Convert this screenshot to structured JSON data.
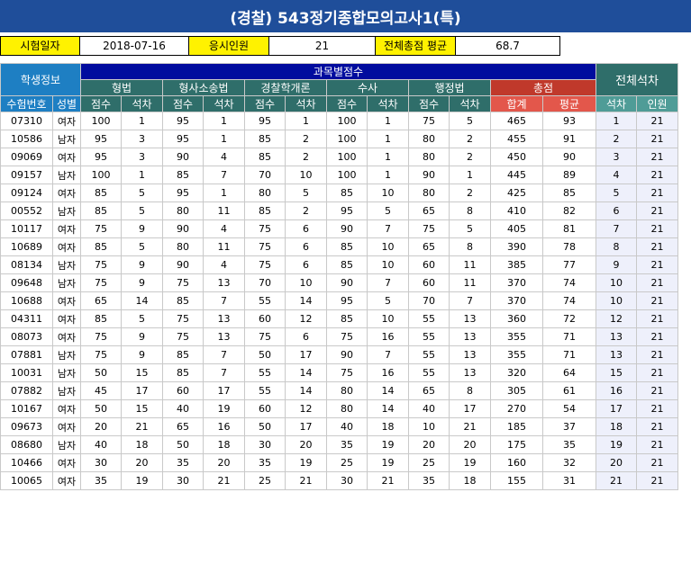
{
  "title": "(경찰) 543정기종합모의고사1(특)",
  "info": {
    "exam_date_label": "시험일자",
    "exam_date": "2018-07-16",
    "applicants_label": "응시인원",
    "applicants": "21",
    "avg_label": "전체총점 평균",
    "avg": "68.7"
  },
  "headers": {
    "student_info": "학생정보",
    "subject_scores": "과목별점수",
    "overall_rank": "전체석차",
    "subjects": [
      "형법",
      "형사소송법",
      "경찰학개론",
      "수사",
      "행정법"
    ],
    "total": "총점",
    "id": "수험번호",
    "sex": "성별",
    "score": "점수",
    "rank": "석차",
    "sum": "합계",
    "average": "평균",
    "overall_rank_col": "석차",
    "count": "인원"
  },
  "rows": [
    [
      "07310",
      "여자",
      "100",
      "1",
      "95",
      "1",
      "95",
      "1",
      "100",
      "1",
      "75",
      "5",
      "465",
      "93",
      "1",
      "21"
    ],
    [
      "10586",
      "남자",
      "95",
      "3",
      "95",
      "1",
      "85",
      "2",
      "100",
      "1",
      "80",
      "2",
      "455",
      "91",
      "2",
      "21"
    ],
    [
      "09069",
      "여자",
      "95",
      "3",
      "90",
      "4",
      "85",
      "2",
      "100",
      "1",
      "80",
      "2",
      "450",
      "90",
      "3",
      "21"
    ],
    [
      "09157",
      "남자",
      "100",
      "1",
      "85",
      "7",
      "70",
      "10",
      "100",
      "1",
      "90",
      "1",
      "445",
      "89",
      "4",
      "21"
    ],
    [
      "09124",
      "여자",
      "85",
      "5",
      "95",
      "1",
      "80",
      "5",
      "85",
      "10",
      "80",
      "2",
      "425",
      "85",
      "5",
      "21"
    ],
    [
      "00552",
      "남자",
      "85",
      "5",
      "80",
      "11",
      "85",
      "2",
      "95",
      "5",
      "65",
      "8",
      "410",
      "82",
      "6",
      "21"
    ],
    [
      "10117",
      "여자",
      "75",
      "9",
      "90",
      "4",
      "75",
      "6",
      "90",
      "7",
      "75",
      "5",
      "405",
      "81",
      "7",
      "21"
    ],
    [
      "10689",
      "여자",
      "85",
      "5",
      "80",
      "11",
      "75",
      "6",
      "85",
      "10",
      "65",
      "8",
      "390",
      "78",
      "8",
      "21"
    ],
    [
      "08134",
      "남자",
      "75",
      "9",
      "90",
      "4",
      "75",
      "6",
      "85",
      "10",
      "60",
      "11",
      "385",
      "77",
      "9",
      "21"
    ],
    [
      "09648",
      "남자",
      "75",
      "9",
      "75",
      "13",
      "70",
      "10",
      "90",
      "7",
      "60",
      "11",
      "370",
      "74",
      "10",
      "21"
    ],
    [
      "10688",
      "여자",
      "65",
      "14",
      "85",
      "7",
      "55",
      "14",
      "95",
      "5",
      "70",
      "7",
      "370",
      "74",
      "10",
      "21"
    ],
    [
      "04311",
      "여자",
      "85",
      "5",
      "75",
      "13",
      "60",
      "12",
      "85",
      "10",
      "55",
      "13",
      "360",
      "72",
      "12",
      "21"
    ],
    [
      "08073",
      "여자",
      "75",
      "9",
      "75",
      "13",
      "75",
      "6",
      "75",
      "16",
      "55",
      "13",
      "355",
      "71",
      "13",
      "21"
    ],
    [
      "07881",
      "남자",
      "75",
      "9",
      "85",
      "7",
      "50",
      "17",
      "90",
      "7",
      "55",
      "13",
      "355",
      "71",
      "13",
      "21"
    ],
    [
      "10031",
      "남자",
      "50",
      "15",
      "85",
      "7",
      "55",
      "14",
      "75",
      "16",
      "55",
      "13",
      "320",
      "64",
      "15",
      "21"
    ],
    [
      "07882",
      "남자",
      "45",
      "17",
      "60",
      "17",
      "55",
      "14",
      "80",
      "14",
      "65",
      "8",
      "305",
      "61",
      "16",
      "21"
    ],
    [
      "10167",
      "여자",
      "50",
      "15",
      "40",
      "19",
      "60",
      "12",
      "80",
      "14",
      "40",
      "17",
      "270",
      "54",
      "17",
      "21"
    ],
    [
      "09673",
      "여자",
      "20",
      "21",
      "65",
      "16",
      "50",
      "17",
      "40",
      "18",
      "10",
      "21",
      "185",
      "37",
      "18",
      "21"
    ],
    [
      "08680",
      "남자",
      "40",
      "18",
      "50",
      "18",
      "30",
      "20",
      "35",
      "19",
      "20",
      "20",
      "175",
      "35",
      "19",
      "21"
    ],
    [
      "10466",
      "여자",
      "30",
      "20",
      "35",
      "20",
      "35",
      "19",
      "25",
      "19",
      "25",
      "19",
      "160",
      "32",
      "20",
      "21"
    ],
    [
      "10065",
      "여자",
      "35",
      "19",
      "30",
      "21",
      "25",
      "21",
      "30",
      "21",
      "35",
      "18",
      "155",
      "31",
      "21",
      "21"
    ]
  ]
}
